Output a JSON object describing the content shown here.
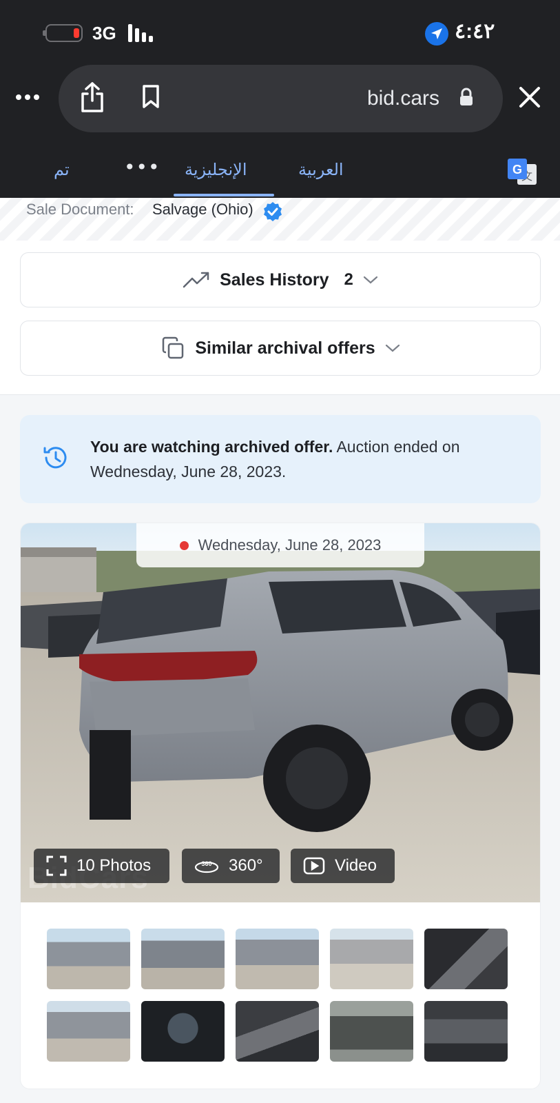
{
  "status_bar": {
    "network": "3G",
    "time": "٤:٤٢",
    "icons": [
      "battery-icon",
      "signal-icon",
      "location-icon"
    ],
    "battery_state": "low"
  },
  "browser": {
    "url": "bid.cars",
    "icons": [
      "more-icon",
      "share-icon",
      "bookmark-icon",
      "lock-icon",
      "close-icon"
    ]
  },
  "translate_bar": {
    "done_label": "تم",
    "more_label": "•••",
    "tabs": [
      {
        "label": "الإنجليزية",
        "selected": true
      },
      {
        "label": "العربية",
        "selected": false
      }
    ],
    "icon": "google-translate-icon"
  },
  "sale_document": {
    "label": "Sale Document:",
    "value": "Salvage (Ohio)",
    "icon": "verified-icon"
  },
  "accordions": {
    "sales_history": {
      "label": "Sales History",
      "count": "2",
      "icon": "trend-up-icon"
    },
    "similar_offers": {
      "label": "Similar archival offers",
      "icon": "copy-icon"
    }
  },
  "notice": {
    "bold": "You are watching archived offer.",
    "text": " Auction ended on Wednesday, June 28, 2023.",
    "icon": "history-icon",
    "color": "#e6f1fb"
  },
  "gallery": {
    "date": "Wednesday, June 28, 2023",
    "photos_label": "10 Photos",
    "view360_label": "360°",
    "video_label": "Video",
    "watermark": "BidCars",
    "thumbnail_count": 10
  },
  "colors": {
    "chrome_bg": "#202124",
    "accent_blue": "#8ab4f8",
    "page_bg": "#f4f6f8"
  }
}
